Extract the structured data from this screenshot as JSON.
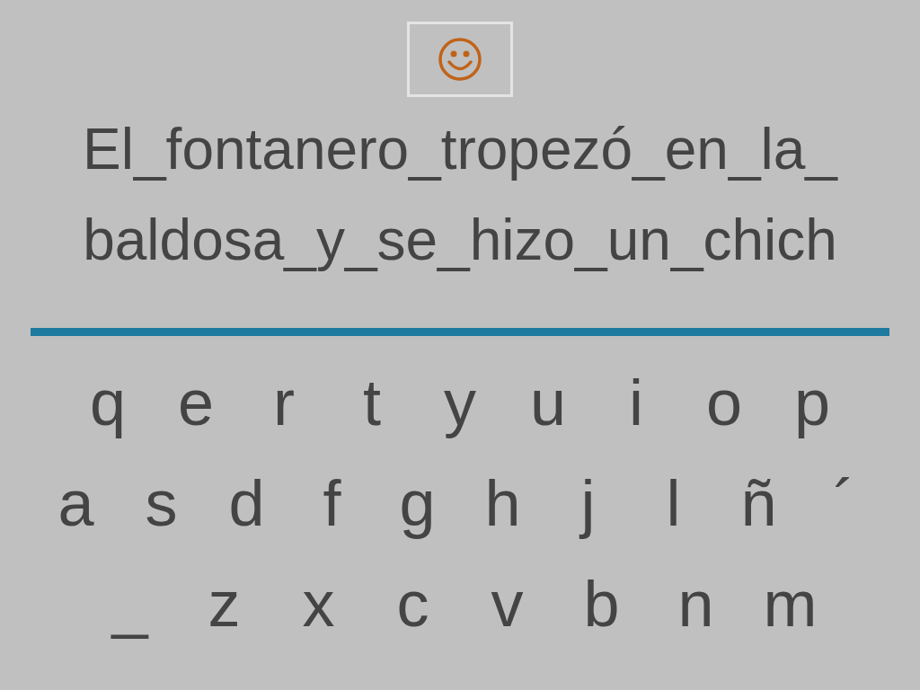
{
  "phrase_lines": [
    "El_fontanero_tropezó_en_la_",
    "baldosa_y_se_hizo_un_chich"
  ],
  "keyboard": {
    "rows": [
      [
        "q",
        "e",
        "r",
        "t",
        "y",
        "u",
        "i",
        "o",
        "p"
      ],
      [
        "a",
        "s",
        "d",
        "f",
        "g",
        "h",
        "j",
        "l",
        "ñ",
        "´"
      ],
      [
        "_",
        "z",
        "x",
        "c",
        "v",
        "b",
        "n",
        "m"
      ]
    ]
  }
}
